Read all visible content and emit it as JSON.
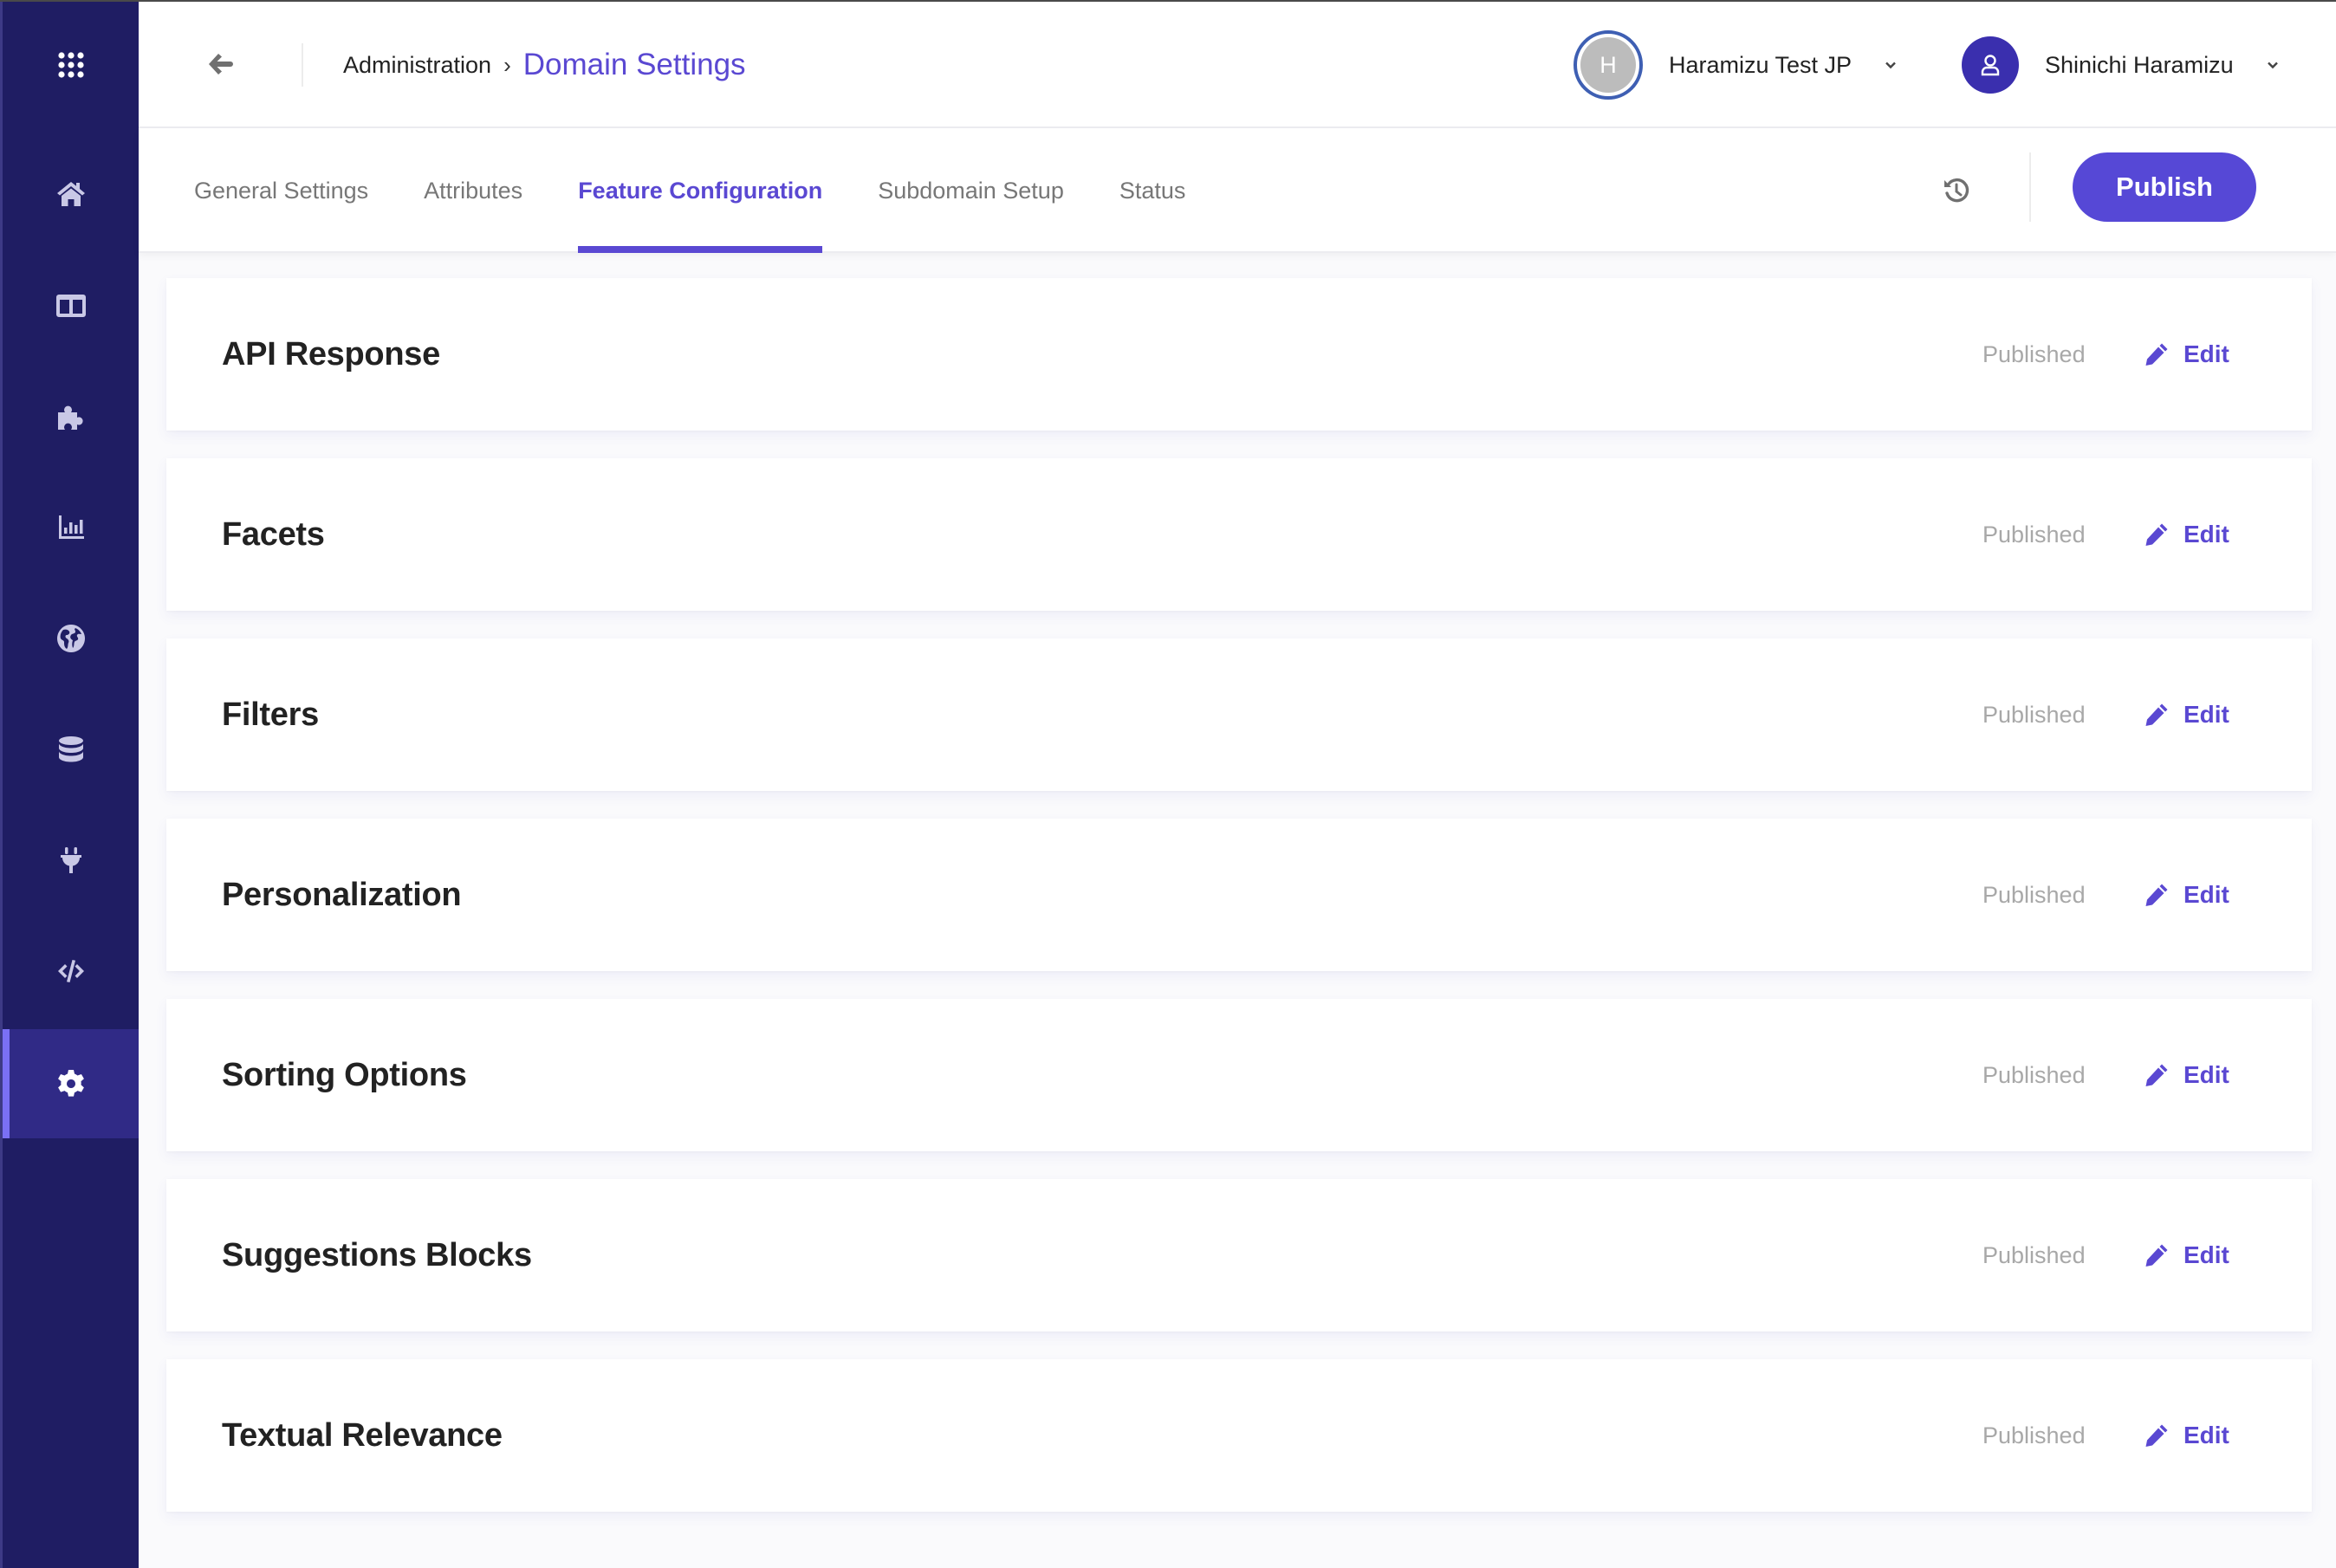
{
  "colors": {
    "sidebar_bg": "#1f1d63",
    "sidebar_active_bg": "#302a86",
    "sidebar_active_indicator": "#7a70f5",
    "accent": "#5a48d2",
    "publish_button": "#5648d6",
    "status_text": "#a8a8a8",
    "avatar_ring": "#3e5fb3",
    "avatar_fill": "#bcbcbc",
    "user_avatar_bg": "#3a2fae"
  },
  "sidebar": {
    "items": [
      {
        "icon": "app-grid-icon",
        "label": "Apps"
      },
      {
        "icon": "home-icon",
        "label": "Home"
      },
      {
        "icon": "columns-icon",
        "label": "Layout"
      },
      {
        "icon": "puzzle-icon",
        "label": "Integrations"
      },
      {
        "icon": "bar-chart-icon",
        "label": "Analytics"
      },
      {
        "icon": "globe-icon",
        "label": "Domains"
      },
      {
        "icon": "database-icon",
        "label": "Data"
      },
      {
        "icon": "plug-icon",
        "label": "Connectors"
      },
      {
        "icon": "code-icon",
        "label": "Developer"
      },
      {
        "icon": "gear-icon",
        "label": "Administration",
        "active": true
      }
    ]
  },
  "header": {
    "back_icon": "arrow-left-icon",
    "breadcrumb": {
      "parent": "Administration",
      "separator": "›",
      "current": "Domain Settings"
    },
    "account": {
      "avatar_initial": "H",
      "name": "Haramizu Test JP"
    },
    "user": {
      "avatar_icon": "user-icon",
      "name": "Shinichi Haramizu"
    }
  },
  "tabs": {
    "items": [
      {
        "label": "General Settings",
        "active": false
      },
      {
        "label": "Attributes",
        "active": false
      },
      {
        "label": "Feature Configuration",
        "active": true
      },
      {
        "label": "Subdomain Setup",
        "active": false
      },
      {
        "label": "Status",
        "active": false
      }
    ],
    "history_icon": "history-icon",
    "publish_label": "Publish"
  },
  "features": [
    {
      "title": "API Response",
      "status": "Published",
      "edit_label": "Edit"
    },
    {
      "title": "Facets",
      "status": "Published",
      "edit_label": "Edit"
    },
    {
      "title": "Filters",
      "status": "Published",
      "edit_label": "Edit"
    },
    {
      "title": "Personalization",
      "status": "Published",
      "edit_label": "Edit"
    },
    {
      "title": "Sorting Options",
      "status": "Published",
      "edit_label": "Edit"
    },
    {
      "title": "Suggestions Blocks",
      "status": "Published",
      "edit_label": "Edit"
    },
    {
      "title": "Textual Relevance",
      "status": "Published",
      "edit_label": "Edit"
    }
  ]
}
